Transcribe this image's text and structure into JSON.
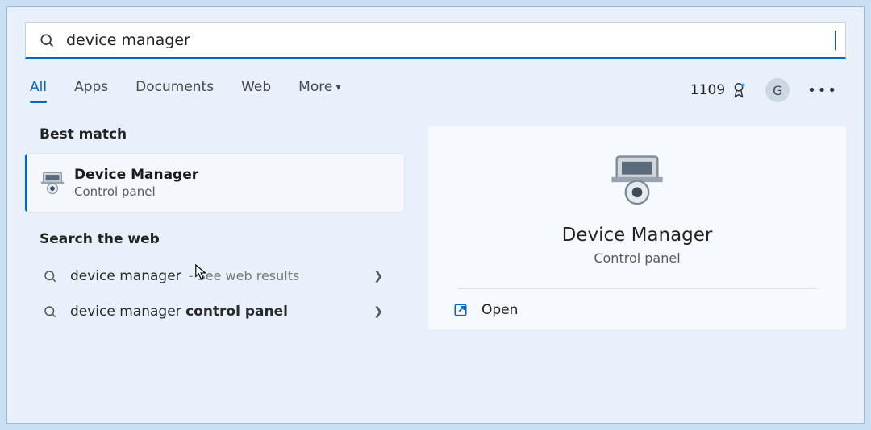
{
  "search": {
    "query": "device manager"
  },
  "tabs": {
    "all": "All",
    "apps": "Apps",
    "documents": "Documents",
    "web": "Web",
    "more": "More"
  },
  "header": {
    "points": "1109",
    "avatarInitial": "G"
  },
  "sections": {
    "bestMatch": "Best match",
    "searchWeb": "Search the web"
  },
  "bestMatch": {
    "title": "Device Manager",
    "subtitle": "Control panel"
  },
  "webResults": [
    {
      "query": "device manager",
      "hint": "See web results",
      "boldPart": ""
    },
    {
      "query": "device manager ",
      "hint": "",
      "boldPart": "control panel"
    }
  ],
  "detail": {
    "title": "Device Manager",
    "subtitle": "Control panel",
    "open": "Open"
  }
}
